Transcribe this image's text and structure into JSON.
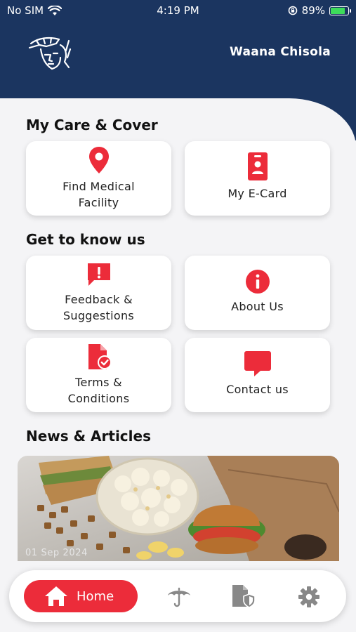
{
  "status_bar": {
    "carrier": "No SIM",
    "time": "4:19 PM",
    "battery": "89%",
    "battery_level": 0.89
  },
  "header": {
    "user_name": "Waana Chisola"
  },
  "sections": {
    "care": {
      "title": "My Care & Cover",
      "cards": [
        {
          "label": "Find Medical\nFacility",
          "icon": "location-pin-icon"
        },
        {
          "label": "My E-Card",
          "icon": "id-badge-icon"
        }
      ]
    },
    "about": {
      "title": "Get to know us",
      "cards": [
        {
          "label": "Feedback &\nSuggestions",
          "icon": "feedback-icon"
        },
        {
          "label": "About Us",
          "icon": "info-icon"
        },
        {
          "label": "Terms &\nConditions",
          "icon": "document-check-icon"
        },
        {
          "label": "Contact us",
          "icon": "chat-bubble-icon"
        }
      ]
    },
    "news": {
      "title": "News & Articles",
      "articles": [
        {
          "date": "01 Sep 2024"
        }
      ]
    }
  },
  "tabbar": {
    "home_label": "Home",
    "tabs": [
      "home-icon",
      "umbrella-icon",
      "policy-document-icon",
      "gear-icon"
    ]
  },
  "colors": {
    "header_bg": "#1b3560",
    "accent": "#ec2c3a",
    "background": "#f4f4f6"
  }
}
